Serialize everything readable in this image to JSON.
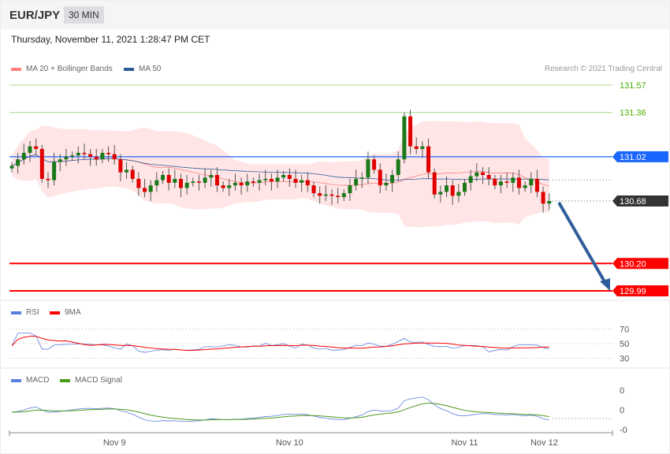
{
  "header": {
    "symbol": "EUR/JPY",
    "timeframe": "30 MIN",
    "datetime": "Thursday, November 11, 2021 1:28:47 PM CET"
  },
  "legend": {
    "ma20": "MA 20 + Bollinger Bands",
    "ma50": "MA 50",
    "rsi": "RSI",
    "rsi_ma": "9MA",
    "macd": "MACD",
    "macd_signal": "MACD Signal",
    "copyright": "Research © 2021 Trading Central"
  },
  "colors": {
    "bb": "#ff8080",
    "ma50": "#2f5d9a",
    "rsi": "#5a7de0",
    "ma9": "#ff0000",
    "macd": "#5a7de0",
    "signal": "#4a9a1a",
    "up": "#1a7a1a",
    "down": "#e00000"
  },
  "chart_data": {
    "type": "candlestick",
    "symbol": "EUR/JPY",
    "ylim": [
      129.99,
      131.57
    ],
    "levels": [
      {
        "value": "131.57",
        "kind": "resistance2",
        "color": "#4caf00"
      },
      {
        "value": "131.36",
        "kind": "resistance1",
        "color": "#4caf00"
      },
      {
        "value": "131.02",
        "kind": "pivot",
        "color": "#1a66ff"
      },
      {
        "value": "130.68",
        "kind": "last",
        "color": "#333333"
      },
      {
        "value": "130.20",
        "kind": "support1",
        "color": "#ff0000"
      },
      {
        "value": "129.99",
        "kind": "support2",
        "color": "#ff0000"
      }
    ],
    "closes": [
      130.95,
      131.0,
      131.05,
      131.1,
      131.08,
      130.85,
      130.84,
      130.98,
      131.0,
      131.02,
      131.03,
      131.05,
      131.04,
      131.02,
      131.0,
      131.05,
      131.04,
      131.0,
      130.9,
      130.92,
      130.85,
      130.78,
      130.75,
      130.8,
      130.84,
      130.88,
      130.82,
      130.85,
      130.78,
      130.82,
      130.83,
      130.82,
      130.86,
      130.88,
      130.8,
      130.78,
      130.8,
      130.82,
      130.8,
      130.83,
      130.82,
      130.84,
      130.85,
      130.83,
      130.86,
      130.88,
      130.85,
      130.82,
      130.84,
      130.8,
      130.74,
      130.72,
      130.73,
      130.72,
      130.71,
      130.74,
      130.8,
      130.85,
      130.86,
      131.0,
      130.92,
      130.8,
      130.82,
      130.88,
      131.0,
      131.33,
      131.1,
      131.08,
      131.1,
      130.9,
      130.73,
      130.75,
      130.8,
      130.72,
      130.75,
      130.82,
      130.87,
      130.9,
      130.88,
      130.85,
      130.8,
      130.83,
      130.82,
      130.86,
      130.78,
      130.8,
      130.85,
      130.75,
      130.66,
      130.68
    ],
    "rsi_ticks": [
      "70",
      "50",
      "30"
    ],
    "macd_ticks": [
      "0",
      "0",
      "-0"
    ],
    "x_ticks": [
      {
        "label": "Nov 9",
        "index": 17
      },
      {
        "label": "Nov 10",
        "index": 46
      },
      {
        "label": "Nov 11",
        "index": 75
      },
      {
        "label": "Nov 12",
        "index": 90
      }
    ]
  }
}
